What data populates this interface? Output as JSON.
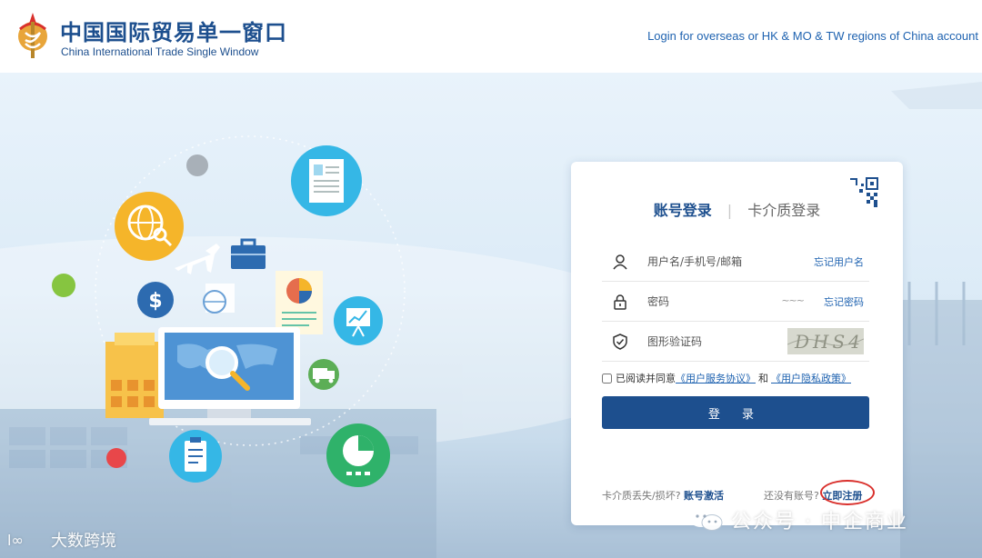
{
  "header": {
    "brand_cn": "中国国际贸易单一窗口",
    "brand_en": "China International Trade Single Window",
    "overseas_link": "Login for overseas or HK & MO & TW regions of China account"
  },
  "login": {
    "tab_account": "账号登录",
    "tab_card": "卡介质登录",
    "username_placeholder": "用户名/手机号/邮箱",
    "forgot_username": "忘记用户名",
    "password_placeholder": "密码",
    "forgot_password": "忘记密码",
    "captcha_placeholder": "图形验证码",
    "captcha_text": "DHS4",
    "agree_prefix": "已阅读并同意",
    "service_agreement": "《用户服务协议》",
    "agree_and": "和",
    "privacy_policy": "《用户隐私政策》",
    "login_button": "登 录",
    "card_lost_prefix": "卡介质丢失/损坏?",
    "account_activate": "账号激活",
    "no_account_prefix": "还没有账号?",
    "register_now": "立即注册"
  },
  "watermarks": {
    "right": "公众号 · 中企商业",
    "left": "大数跨境"
  },
  "colors": {
    "brand_blue": "#1d4f8e",
    "link_blue": "#1e62b0",
    "highlight_red": "#d9302c"
  }
}
